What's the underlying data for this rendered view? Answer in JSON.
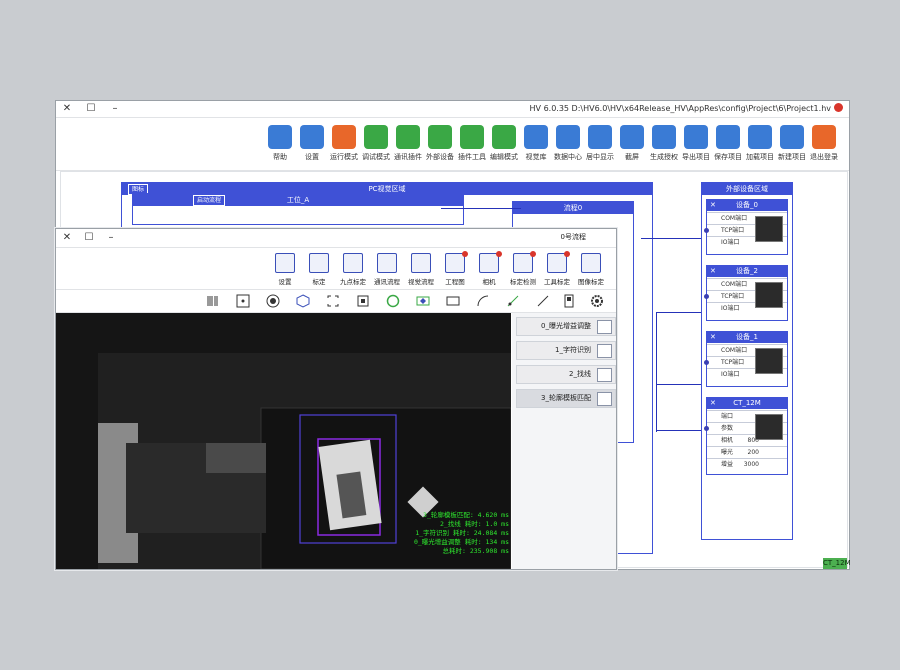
{
  "app": {
    "title": "HV 6.0.35  D:\\HV6.0\\HV\\x64Release_HV\\AppRes\\config\\Project\\6\\Project1.hv"
  },
  "toolbar": {
    "items": [
      {
        "label": "退出登录",
        "color": "#e8672a"
      },
      {
        "label": "新建项目",
        "color": "#3a7bd5"
      },
      {
        "label": "加载项目",
        "color": "#3a7bd5"
      },
      {
        "label": "保存项目",
        "color": "#3a7bd5"
      },
      {
        "label": "导出项目",
        "color": "#3a7bd5"
      },
      {
        "label": "生成授权",
        "color": "#3a7bd5"
      },
      {
        "label": "截屏",
        "color": "#3a7bd5"
      },
      {
        "label": "居中显示",
        "color": "#3a7bd5"
      },
      {
        "label": "数据中心",
        "color": "#3a7bd5"
      },
      {
        "label": "视觉库",
        "color": "#3a7bd5"
      },
      {
        "label": "编辑模式",
        "color": "#3aa845"
      },
      {
        "label": "插件工具",
        "color": "#3aa845"
      },
      {
        "label": "外部设备",
        "color": "#3aa845"
      },
      {
        "label": "通讯插件",
        "color": "#3aa845"
      },
      {
        "label": "调试模式",
        "color": "#3aa845"
      },
      {
        "label": "运行模式",
        "color": "#e8672a"
      },
      {
        "label": "设置",
        "color": "#3a7bd5"
      },
      {
        "label": "帮助",
        "color": "#3a7bd5"
      }
    ]
  },
  "canvas": {
    "pc_panel_title": "PC视觉区域",
    "station": "工位_A",
    "station_btn": "启动流程",
    "flow": "流程0",
    "main_cam": "图标"
  },
  "devices": {
    "title": "外部设备区域",
    "list": [
      {
        "name": "设备_0",
        "rows": [
          "COM端口",
          "TCP端口",
          "IO端口"
        ]
      },
      {
        "name": "设备_2",
        "rows": [
          "COM端口",
          "TCP端口",
          "IO端口"
        ]
      },
      {
        "name": "设备_1",
        "rows": [
          "COM端口",
          "TCP端口",
          "IO端口"
        ]
      },
      {
        "name": "CT_12M",
        "rows": [
          "端口",
          "参数",
          "相机",
          "曝光",
          "增益"
        ],
        "values": [
          "800",
          "200",
          "3000"
        ]
      }
    ]
  },
  "inner": {
    "tabs": [
      "0号流程"
    ],
    "tools": [
      {
        "label": "图像标定"
      },
      {
        "label": "工具标定"
      },
      {
        "label": "标定检测"
      },
      {
        "label": "相机"
      },
      {
        "label": "工程图"
      },
      {
        "label": "视觉流程"
      },
      {
        "label": "通讯流程"
      },
      {
        "label": "九点标定"
      },
      {
        "label": "标定"
      },
      {
        "label": "设置"
      }
    ],
    "steps": [
      {
        "label": "0_曝光增益调整"
      },
      {
        "label": "1_字符识别"
      },
      {
        "label": "2_找线"
      },
      {
        "label": "3_轮廓模板匹配"
      }
    ],
    "readouts": [
      "3_轮廓模板匹配: 4.620 ms",
      "2_找线 耗时: 1.0 ms",
      "1_字符识别 耗时: 24.084 ms",
      "0_曝光增益调整 耗时: 134 ms",
      "总耗时: 235.908 ms"
    ]
  },
  "status": {
    "camera": "CT_12M"
  }
}
